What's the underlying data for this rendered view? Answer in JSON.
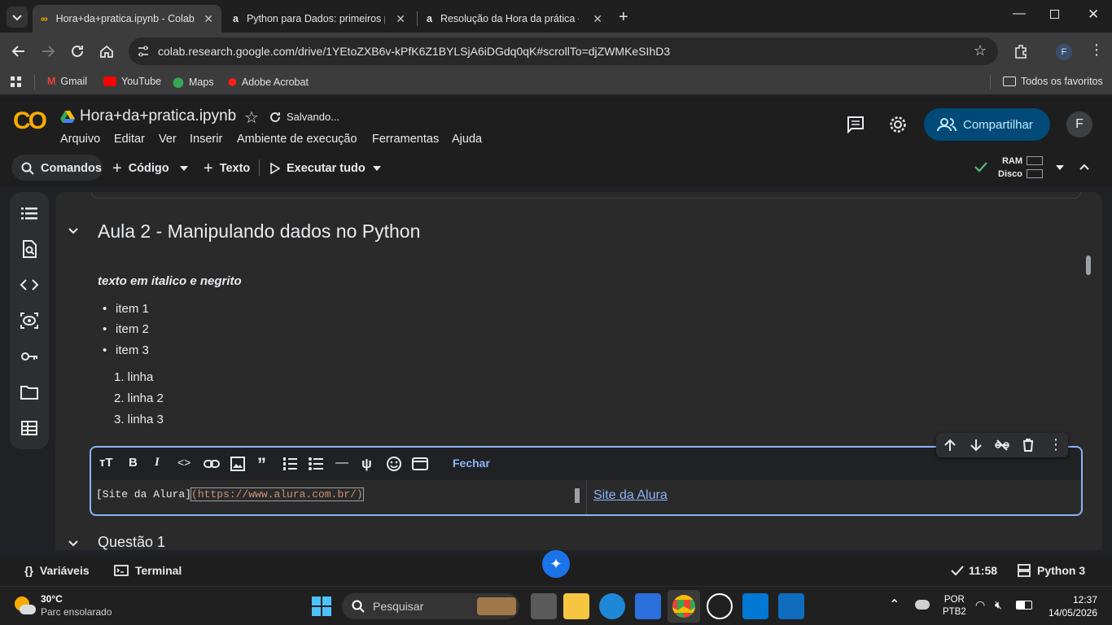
{
  "browser": {
    "tabs": [
      {
        "title": "Hora+da+pratica.ipynb - Colab",
        "active": true
      },
      {
        "title": "Python para Dados: primeiros p",
        "active": false
      },
      {
        "title": "Resolução da Hora da prática -",
        "active": false
      }
    ],
    "url": "colab.research.google.com/drive/1YEtoZXB6v-kPfK6Z1BYLSjA6iDGdq0qK#scrollTo=djZWMKeSIhD3",
    "profile_initial": "F",
    "bookmarks": [
      "Gmail",
      "YouTube",
      "Maps",
      "Adobe Acrobat"
    ],
    "all_bookmarks": "Todos os favoritos"
  },
  "colab": {
    "logo": "CO",
    "notebook_title": "Hora+da+pratica.ipynb",
    "save_status": "Salvando...",
    "menu": [
      "Arquivo",
      "Editar",
      "Ver",
      "Inserir",
      "Ambiente de execução",
      "Ferramentas",
      "Ajuda"
    ],
    "share_label": "Compartilhar",
    "user_initial": "F",
    "toolbar": {
      "commands": "Comandos",
      "code": "Código",
      "text": "Texto",
      "run_all": "Executar tudo",
      "ram": "RAM",
      "disk": "Disco"
    }
  },
  "notebook": {
    "section_title": "Aula 2 - Manipulando dados no Python",
    "bold_italic": "texto em italico e negrito",
    "bullets": [
      "item 1",
      "item 2",
      "item 3"
    ],
    "numbered": [
      "1. linha",
      "2. linha 2",
      "3. linha 3"
    ],
    "editor": {
      "close_label": "Fechar",
      "source_text_part": "[Site da Alura]",
      "source_url_part": "(https://www.alura.com.br/)",
      "preview_link": "Site da Alura"
    },
    "next_section_title": "Questão 1"
  },
  "statusbar": {
    "variables": "Variáveis",
    "terminal": "Terminal",
    "time": "11:58",
    "runtime": "Python 3"
  },
  "taskbar": {
    "temp": "30°C",
    "weather": "Parc ensolarado",
    "search_placeholder": "Pesquisar",
    "lang": "POR",
    "layout": "PTB2",
    "clock": "12:37",
    "date": "14/05/2026"
  },
  "colors": {
    "accent": "#8ab4f8",
    "share_bg": "#004a77",
    "colab_orange": "#f9ab00"
  }
}
